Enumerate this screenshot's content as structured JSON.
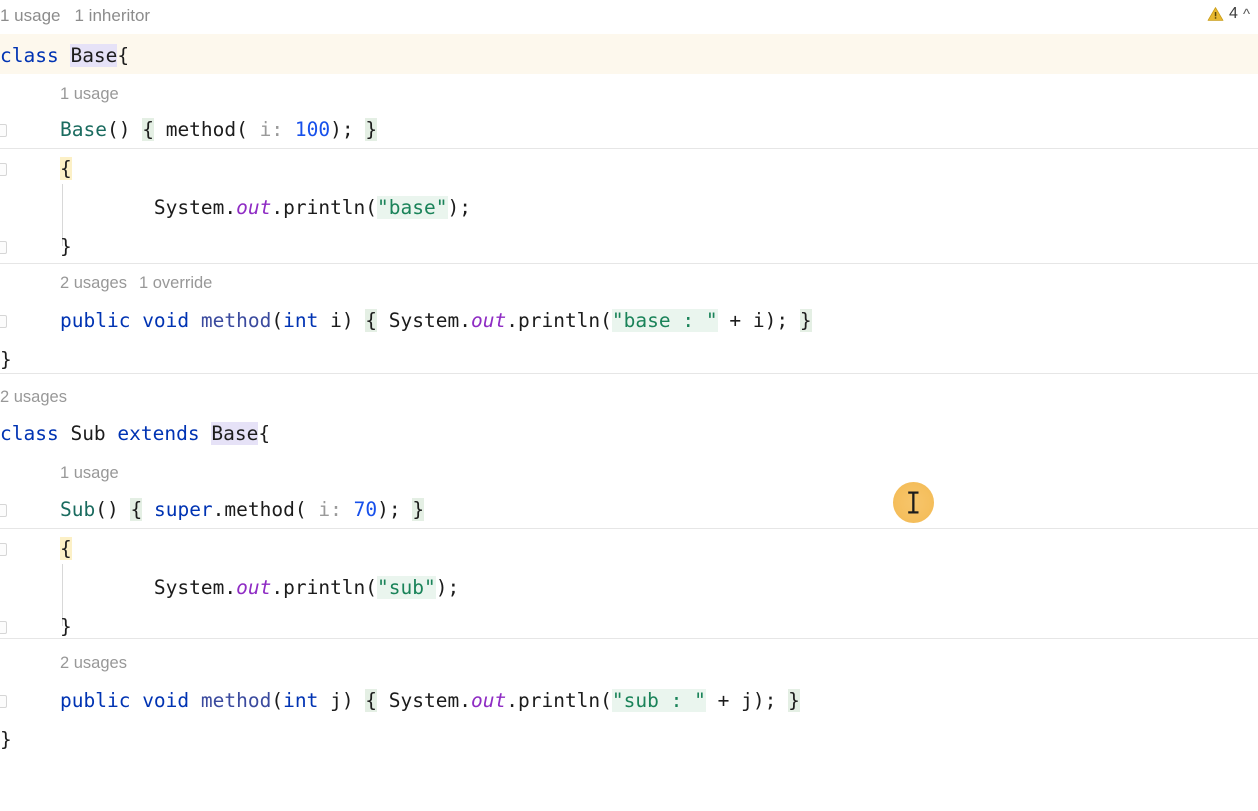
{
  "editor": {
    "app": "java-code-editor",
    "language": "Java",
    "status_bar": {
      "warning_icon": "warning-triangle-icon",
      "warning_count": "4",
      "collapse_icon": "chevron-up-icon"
    },
    "top_hints": {
      "usages": "1 usage",
      "inheritors": "1 inheritor"
    },
    "colors": {
      "keyword": "#0033b3",
      "number": "#1750eb",
      "string": "#1a8359",
      "string_bg": "#eaf5ee",
      "class_name": "#1a6b5f",
      "method_name": "#3a4a9e",
      "static_field_italic": "#8f2cc4",
      "inlay_hint": "#9a9a9a",
      "occurrence_highlight": "#e6e2f7",
      "brace_match_bg": "#e4efe4",
      "block_highlight_bg": "#fcf0c6",
      "caret_line_bg": "#fdf8ed",
      "warning": "#e8b931",
      "cursor_puck": "#f5bf5e",
      "separator": "#e6e6e6",
      "hint_text": "#989898"
    },
    "lines": {
      "class_base": {
        "kw_class": "class ",
        "name": "Base",
        "brace": "{"
      },
      "base_ctor_hint": "1 usage",
      "base_ctor": {
        "name": "Base",
        "parens": "() ",
        "open_brace": "{",
        "space1": " ",
        "method": "method",
        "paren_open": "( ",
        "inlay": "i: ",
        "value": "100",
        "tail": ");",
        "space2": " ",
        "close_brace": "}"
      },
      "base_init_open": "{",
      "base_init_body": {
        "indent": "        ",
        "system": "System",
        "dot1": ".",
        "out": "out",
        "dot2": ".",
        "println": "println",
        "paren_open": "(",
        "string": "\"base\"",
        "tail": ");"
      },
      "base_init_close": "}",
      "base_method_hint": {
        "usages": "2 usages",
        "overrides": "1 override"
      },
      "base_method": {
        "kw_public": "public ",
        "kw_void": "void ",
        "name": "method",
        "paren_open": "(",
        "kw_int": "int",
        "param": " i",
        "paren_close": ") ",
        "open_brace": "{",
        "space1": " ",
        "system": "System",
        "dot1": ".",
        "out": "out",
        "dot2": ".",
        "println": "println",
        "p_open": "(",
        "string": "\"base : \"",
        "concat": " + ",
        "arg": "i",
        "tail": ");",
        "space2": " ",
        "close_brace": "}"
      },
      "base_class_close": "}",
      "sub_class_hint": "2 usages",
      "class_sub": {
        "kw_class": "class ",
        "name": "Sub ",
        "kw_extends": "extends ",
        "parent": "Base",
        "brace": "{"
      },
      "sub_ctor_hint": "1 usage",
      "sub_ctor": {
        "name": "Sub",
        "parens": "() ",
        "open_brace": "{",
        "space1": " ",
        "kw_super": "super",
        "dot": ".",
        "method": "method",
        "paren_open": "( ",
        "inlay": "i: ",
        "value": "70",
        "tail": ");",
        "space2": " ",
        "close_brace": "}"
      },
      "sub_init_open": "{",
      "sub_init_body": {
        "indent": "        ",
        "system": "System",
        "dot1": ".",
        "out": "out",
        "dot2": ".",
        "println": "println",
        "paren_open": "(",
        "string": "\"sub\"",
        "tail": ");"
      },
      "sub_init_close": "}",
      "sub_method_hint": "2 usages",
      "sub_method": {
        "kw_public": "public ",
        "kw_void": "void ",
        "name": "method",
        "paren_open": "(",
        "kw_int": "int",
        "param": " j",
        "paren_close": ") ",
        "open_brace": "{",
        "space1": " ",
        "system": "System",
        "dot1": ".",
        "out": "out",
        "dot2": ".",
        "println": "println",
        "p_open": "(",
        "string": "\"sub : \"",
        "concat": " + ",
        "arg": "j",
        "tail": ");",
        "space2": " ",
        "close_brace": "}"
      },
      "sub_class_close": "}"
    },
    "mouse": {
      "icon": "text-ibeam-cursor"
    }
  }
}
